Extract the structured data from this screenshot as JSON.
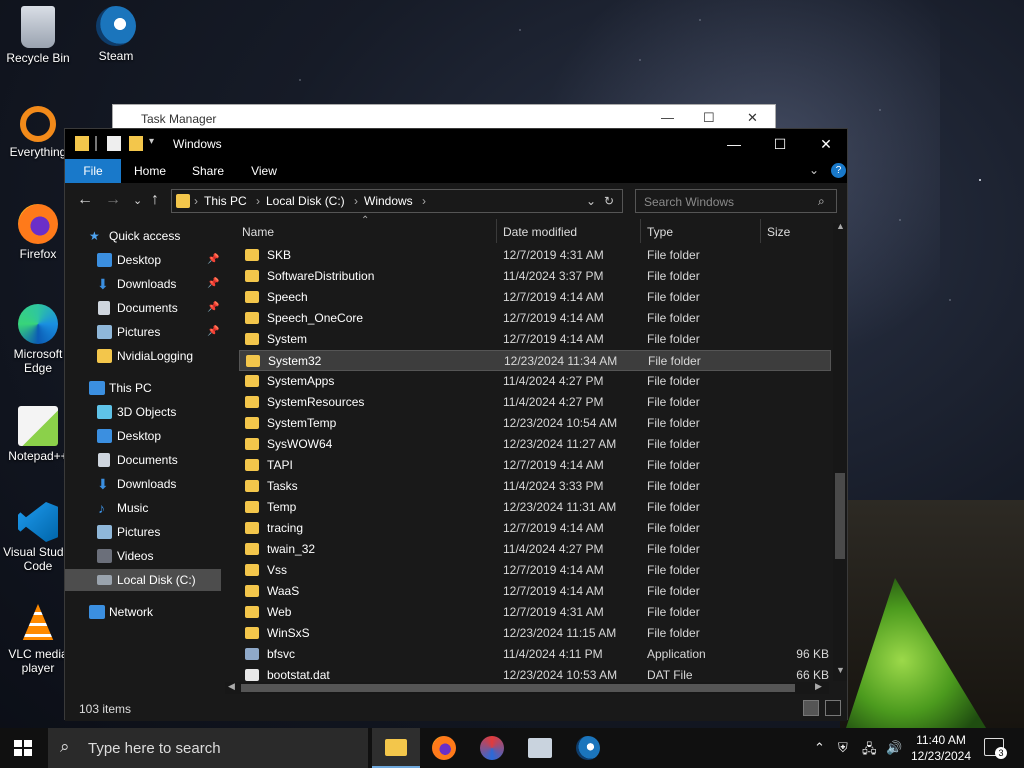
{
  "desktop": {
    "icons": [
      {
        "label": "Recycle Bin",
        "icon": "recycle-bin-icon"
      },
      {
        "label": "Steam",
        "icon": "steam-icon"
      },
      {
        "label": "Everything",
        "icon": "everything-search-icon"
      },
      {
        "label": "Firefox",
        "icon": "firefox-icon"
      },
      {
        "label": "Microsoft Edge",
        "icon": "edge-icon"
      },
      {
        "label": "Notepad++",
        "icon": "notepadpp-icon"
      },
      {
        "label": "Visual Studio Code",
        "icon": "vscode-icon"
      },
      {
        "label": "VLC media player",
        "icon": "vlc-icon"
      }
    ]
  },
  "task_manager": {
    "title": "Task Manager"
  },
  "explorer": {
    "title": "Windows",
    "ribbon_tabs": [
      "File",
      "Home",
      "Share",
      "View"
    ],
    "breadcrumb": [
      "This PC",
      "Local Disk (C:)",
      "Windows"
    ],
    "search_placeholder": "Search Windows",
    "nav": {
      "quick_access": "Quick access",
      "qa_items": [
        "Desktop",
        "Downloads",
        "Documents",
        "Pictures",
        "NvidiaLogging"
      ],
      "this_pc": "This PC",
      "pc_items": [
        "3D Objects",
        "Desktop",
        "Documents",
        "Downloads",
        "Music",
        "Pictures",
        "Videos",
        "Local Disk (C:)"
      ],
      "network": "Network"
    },
    "columns": {
      "name": "Name",
      "date": "Date modified",
      "type": "Type",
      "size": "Size"
    },
    "rows": [
      {
        "name": "SKB",
        "date": "12/7/2019 4:31 AM",
        "type": "File folder",
        "size": ""
      },
      {
        "name": "SoftwareDistribution",
        "date": "11/4/2024 3:37 PM",
        "type": "File folder",
        "size": ""
      },
      {
        "name": "Speech",
        "date": "12/7/2019 4:14 AM",
        "type": "File folder",
        "size": ""
      },
      {
        "name": "Speech_OneCore",
        "date": "12/7/2019 4:14 AM",
        "type": "File folder",
        "size": ""
      },
      {
        "name": "System",
        "date": "12/7/2019 4:14 AM",
        "type": "File folder",
        "size": ""
      },
      {
        "name": "System32",
        "date": "12/23/2024 11:34 AM",
        "type": "File folder",
        "size": ""
      },
      {
        "name": "SystemApps",
        "date": "11/4/2024 4:27 PM",
        "type": "File folder",
        "size": ""
      },
      {
        "name": "SystemResources",
        "date": "11/4/2024 4:27 PM",
        "type": "File folder",
        "size": ""
      },
      {
        "name": "SystemTemp",
        "date": "12/23/2024 10:54 AM",
        "type": "File folder",
        "size": ""
      },
      {
        "name": "SysWOW64",
        "date": "12/23/2024 11:27 AM",
        "type": "File folder",
        "size": ""
      },
      {
        "name": "TAPI",
        "date": "12/7/2019 4:14 AM",
        "type": "File folder",
        "size": ""
      },
      {
        "name": "Tasks",
        "date": "11/4/2024 3:33 PM",
        "type": "File folder",
        "size": ""
      },
      {
        "name": "Temp",
        "date": "12/23/2024 11:31 AM",
        "type": "File folder",
        "size": ""
      },
      {
        "name": "tracing",
        "date": "12/7/2019 4:14 AM",
        "type": "File folder",
        "size": ""
      },
      {
        "name": "twain_32",
        "date": "11/4/2024 4:27 PM",
        "type": "File folder",
        "size": ""
      },
      {
        "name": "Vss",
        "date": "12/7/2019 4:14 AM",
        "type": "File folder",
        "size": ""
      },
      {
        "name": "WaaS",
        "date": "12/7/2019 4:14 AM",
        "type": "File folder",
        "size": ""
      },
      {
        "name": "Web",
        "date": "12/7/2019 4:31 AM",
        "type": "File folder",
        "size": ""
      },
      {
        "name": "WinSxS",
        "date": "12/23/2024 11:15 AM",
        "type": "File folder",
        "size": ""
      },
      {
        "name": "bfsvc",
        "date": "11/4/2024 4:11 PM",
        "type": "Application",
        "size": "96 KB"
      },
      {
        "name": "bootstat.dat",
        "date": "12/23/2024 10:53 AM",
        "type": "DAT File",
        "size": "66 KB"
      }
    ],
    "selected_row": "System32",
    "status": {
      "item_count": "103 items"
    }
  },
  "taskbar": {
    "search_placeholder": "Type here to search",
    "apps": [
      "file-explorer-icon",
      "firefox-icon",
      "app-icon",
      "network-app-icon",
      "steam-icon"
    ],
    "clock_time": "11:40 AM",
    "clock_date": "12/23/2024",
    "notification_count": "3"
  },
  "colors": {
    "accent": "#1979ca",
    "folder": "#f3c64b",
    "window_bg": "#191919"
  }
}
